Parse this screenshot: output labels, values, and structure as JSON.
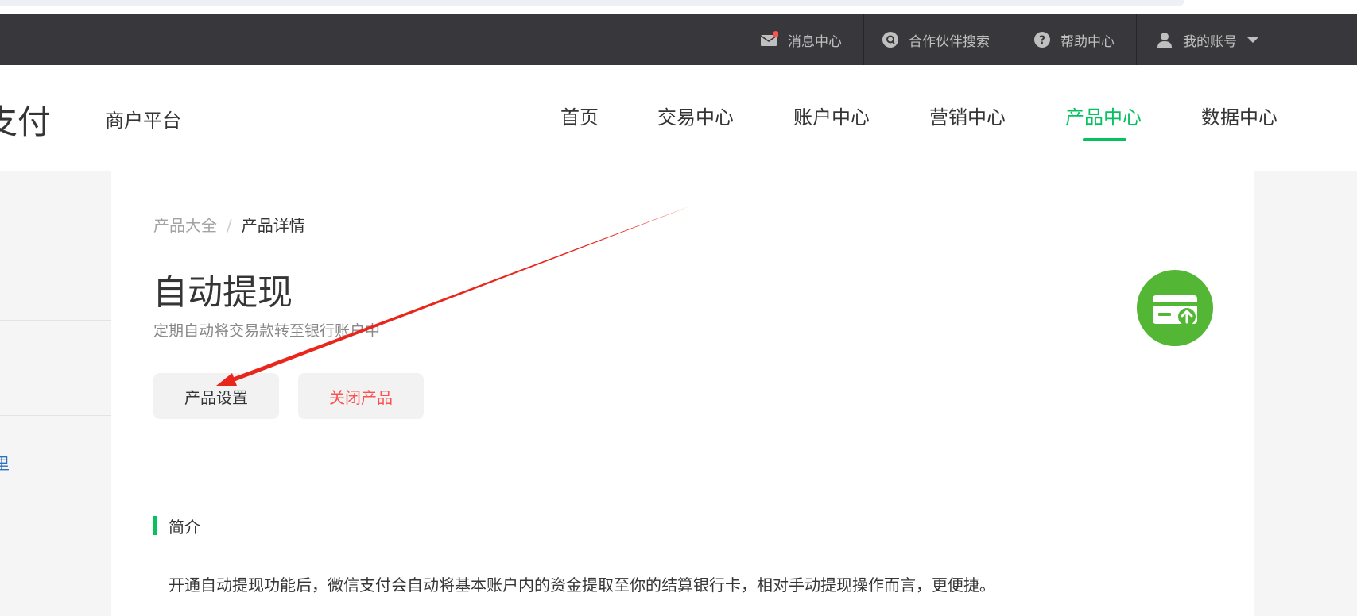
{
  "topbar": {
    "items": [
      {
        "label": "消息中心",
        "icon": "mail-icon"
      },
      {
        "label": "合作伙伴搜索",
        "icon": "partner-search-icon"
      },
      {
        "label": "帮助中心",
        "icon": "help-icon"
      },
      {
        "label": "我的账号",
        "icon": "user-icon"
      }
    ],
    "notification_dot_color": "#fa5151"
  },
  "header": {
    "logo_text": "支付",
    "platform": "商户平台",
    "nav": [
      "首页",
      "交易中心",
      "账户中心",
      "营销中心",
      "产品中心",
      "数据中心"
    ],
    "active_nav": "产品中心"
  },
  "sidebar": {
    "partial_text": "里"
  },
  "breadcrumb": {
    "parent": "产品大全",
    "separator": "/",
    "current": "产品详情"
  },
  "product": {
    "title": "自动提现",
    "description": "定期自动将交易款转至银行账户中",
    "settings_button": "产品设置",
    "close_button": "关闭产品",
    "icon": "card-withdraw-icon"
  },
  "intro": {
    "title": "简介",
    "body": "开通自动提现功能后，微信支付会自动将基本账户内的资金提取至你的结算银行卡，相对手动提现操作而言，更便捷。"
  },
  "colors": {
    "accent": "#07c160",
    "danger": "#fa5151",
    "topbar": "#38383c",
    "product_icon": "#53b735",
    "annotation_arrow": "#e8261b"
  }
}
